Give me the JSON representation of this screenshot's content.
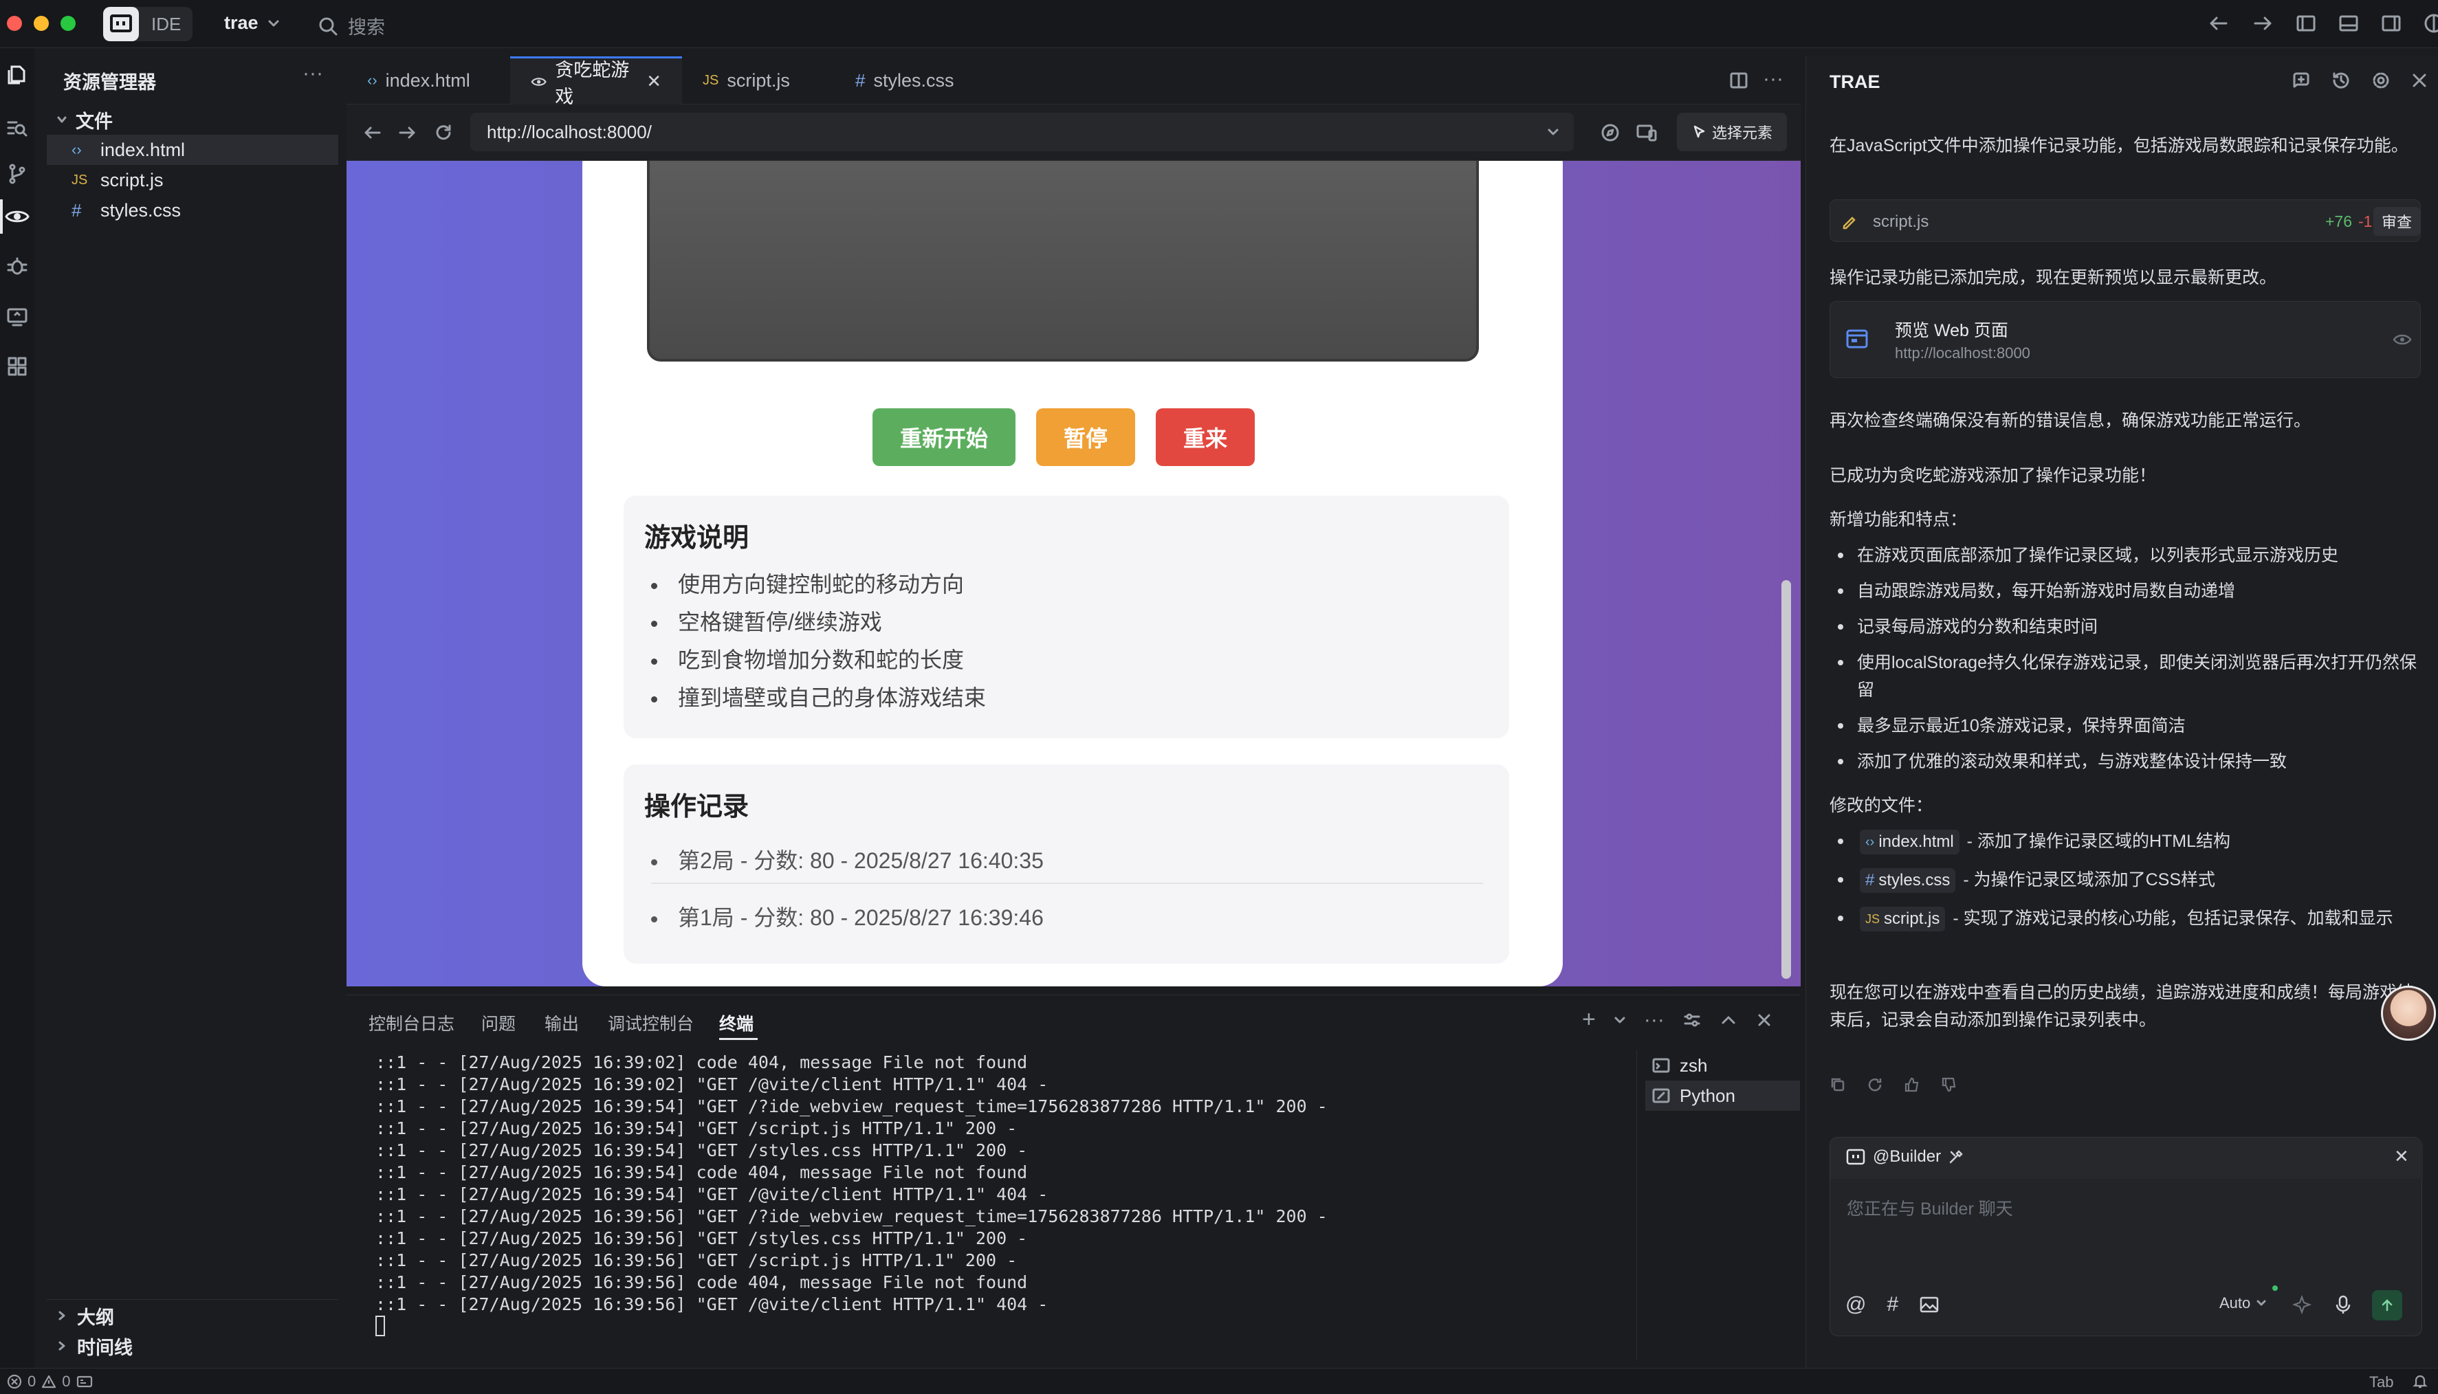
{
  "titlebar": {
    "ide_label": "IDE",
    "project": "trae",
    "search_placeholder": "搜索"
  },
  "explorer": {
    "title": "资源管理器",
    "folder": "文件",
    "files": [
      {
        "name": "index.html",
        "icon": "html-icon"
      },
      {
        "name": "script.js",
        "icon": "js-icon"
      },
      {
        "name": "styles.css",
        "icon": "css-icon"
      }
    ],
    "outline": "大纲",
    "timeline": "时间线"
  },
  "tabs": [
    {
      "label": "index.html",
      "icon": "html-icon"
    },
    {
      "label": "贪吃蛇游戏",
      "icon": "eye-icon",
      "active": true
    },
    {
      "label": "script.js",
      "icon": "js-icon"
    },
    {
      "label": "styles.css",
      "icon": "css-icon"
    }
  ],
  "browser": {
    "url": "http://localhost:8000/",
    "pick_element": "选择元素"
  },
  "game": {
    "buttons": {
      "restart": "重新开始",
      "pause": "暂停",
      "again": "重来"
    },
    "instructions": {
      "title": "游戏说明",
      "items": [
        "使用方向键控制蛇的移动方向",
        "空格键暂停/继续游戏",
        "吃到食物增加分数和蛇的长度",
        "撞到墙壁或自己的身体游戏结束"
      ]
    },
    "records": {
      "title": "操作记录",
      "items": [
        "第2局 - 分数: 80 - 2025/8/27 16:40:35",
        "第1局 - 分数: 80 - 2025/8/27 16:39:46"
      ]
    },
    "colors": {
      "restart": "#5cae5e",
      "pause": "#f0a035",
      "again": "#e2483f"
    }
  },
  "panel": {
    "tabs": [
      "控制台日志",
      "问题",
      "输出",
      "调试控制台",
      "终端"
    ],
    "terminal_lines": [
      "::1 - - [27/Aug/2025 16:39:02] code 404, message File not found",
      "::1 - - [27/Aug/2025 16:39:02] \"GET /@vite/client HTTP/1.1\" 404 -",
      "::1 - - [27/Aug/2025 16:39:54] \"GET /?ide_webview_request_time=1756283877286 HTTP/1.1\" 200 -",
      "::1 - - [27/Aug/2025 16:39:54] \"GET /script.js HTTP/1.1\" 200 -",
      "::1 - - [27/Aug/2025 16:39:54] \"GET /styles.css HTTP/1.1\" 200 -",
      "::1 - - [27/Aug/2025 16:39:54] code 404, message File not found",
      "::1 - - [27/Aug/2025 16:39:54] \"GET /@vite/client HTTP/1.1\" 404 -",
      "::1 - - [27/Aug/2025 16:39:56] \"GET /?ide_webview_request_time=1756283877286 HTTP/1.1\" 200 -",
      "::1 - - [27/Aug/2025 16:39:56] \"GET /styles.css HTTP/1.1\" 200 -",
      "::1 - - [27/Aug/2025 16:39:56] \"GET /script.js HTTP/1.1\" 200 -",
      "::1 - - [27/Aug/2025 16:39:56] code 404, message File not found",
      "::1 - - [27/Aug/2025 16:39:56] \"GET /@vite/client HTTP/1.1\" 404 -"
    ],
    "shells": [
      "zsh",
      "Python"
    ]
  },
  "assistant": {
    "title": "TRAE",
    "msg1": "在JavaScript文件中添加操作记录功能，包括游戏局数跟踪和记录保存功能。",
    "diff": {
      "file": "script.js",
      "added": "+76",
      "removed": "-1",
      "review": "审查"
    },
    "msg2": "操作记录功能已添加完成，现在更新预览以显示最新更改。",
    "preview_card": {
      "title": "预览 Web 页面",
      "url": "http://localhost:8000"
    },
    "msg3": "再次检查终端确保没有新的错误信息，确保游戏功能正常运行。",
    "msg4": "已成功为贪吃蛇游戏添加了操作记录功能！",
    "features_title": "新增功能和特点：",
    "features": [
      "在游戏页面底部添加了操作记录区域，以列表形式显示游戏历史",
      "自动跟踪游戏局数，每开始新游戏时局数自动递增",
      "记录每局游戏的分数和结束时间",
      "使用localStorage持久化保存游戏记录，即使关闭浏览器后再次打开仍然保留",
      "最多显示最近10条游戏记录，保持界面简洁",
      "添加了优雅的滚动效果和样式，与游戏整体设计保持一致"
    ],
    "modified_title": "修改的文件：",
    "modified": [
      {
        "file": "index.html",
        "desc": "- 添加了操作记录区域的HTML结构"
      },
      {
        "file": "styles.css",
        "desc": "- 为操作记录区域添加了CSS样式"
      },
      {
        "file": "script.js",
        "desc": "- 实现了游戏记录的核心功能，包括记录保存、加载和显示"
      }
    ],
    "closing": "现在您可以在游戏中查看自己的历史战绩，追踪游戏进度和成绩！每局游戏结束后，记录会自动添加到操作记录列表中。",
    "input": {
      "agent": "@Builder",
      "placeholder": "您正在与 Builder 聊天",
      "mode": "Auto"
    }
  },
  "status": {
    "errors": "0",
    "warnings": "0",
    "right": "Tab"
  }
}
